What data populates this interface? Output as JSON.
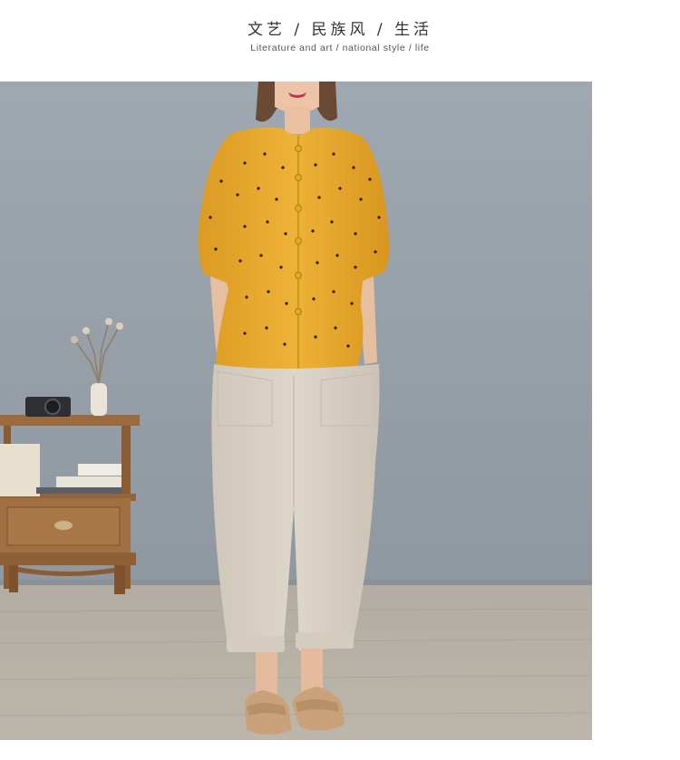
{
  "header": {
    "title_cn": "文艺 / 民族风 / 生活",
    "title_en": "Literature and art / national style / life"
  },
  "photo": {
    "subject": "model-wearing-yellow-polka-dot-blouse-and-beige-linen-pants",
    "colors": {
      "wall": "#9aa3ab",
      "floor": "#b8b2a8",
      "blouse": "#e8a92e",
      "pants": "#d8d1c4",
      "furniture": "#9b6a3e"
    }
  }
}
